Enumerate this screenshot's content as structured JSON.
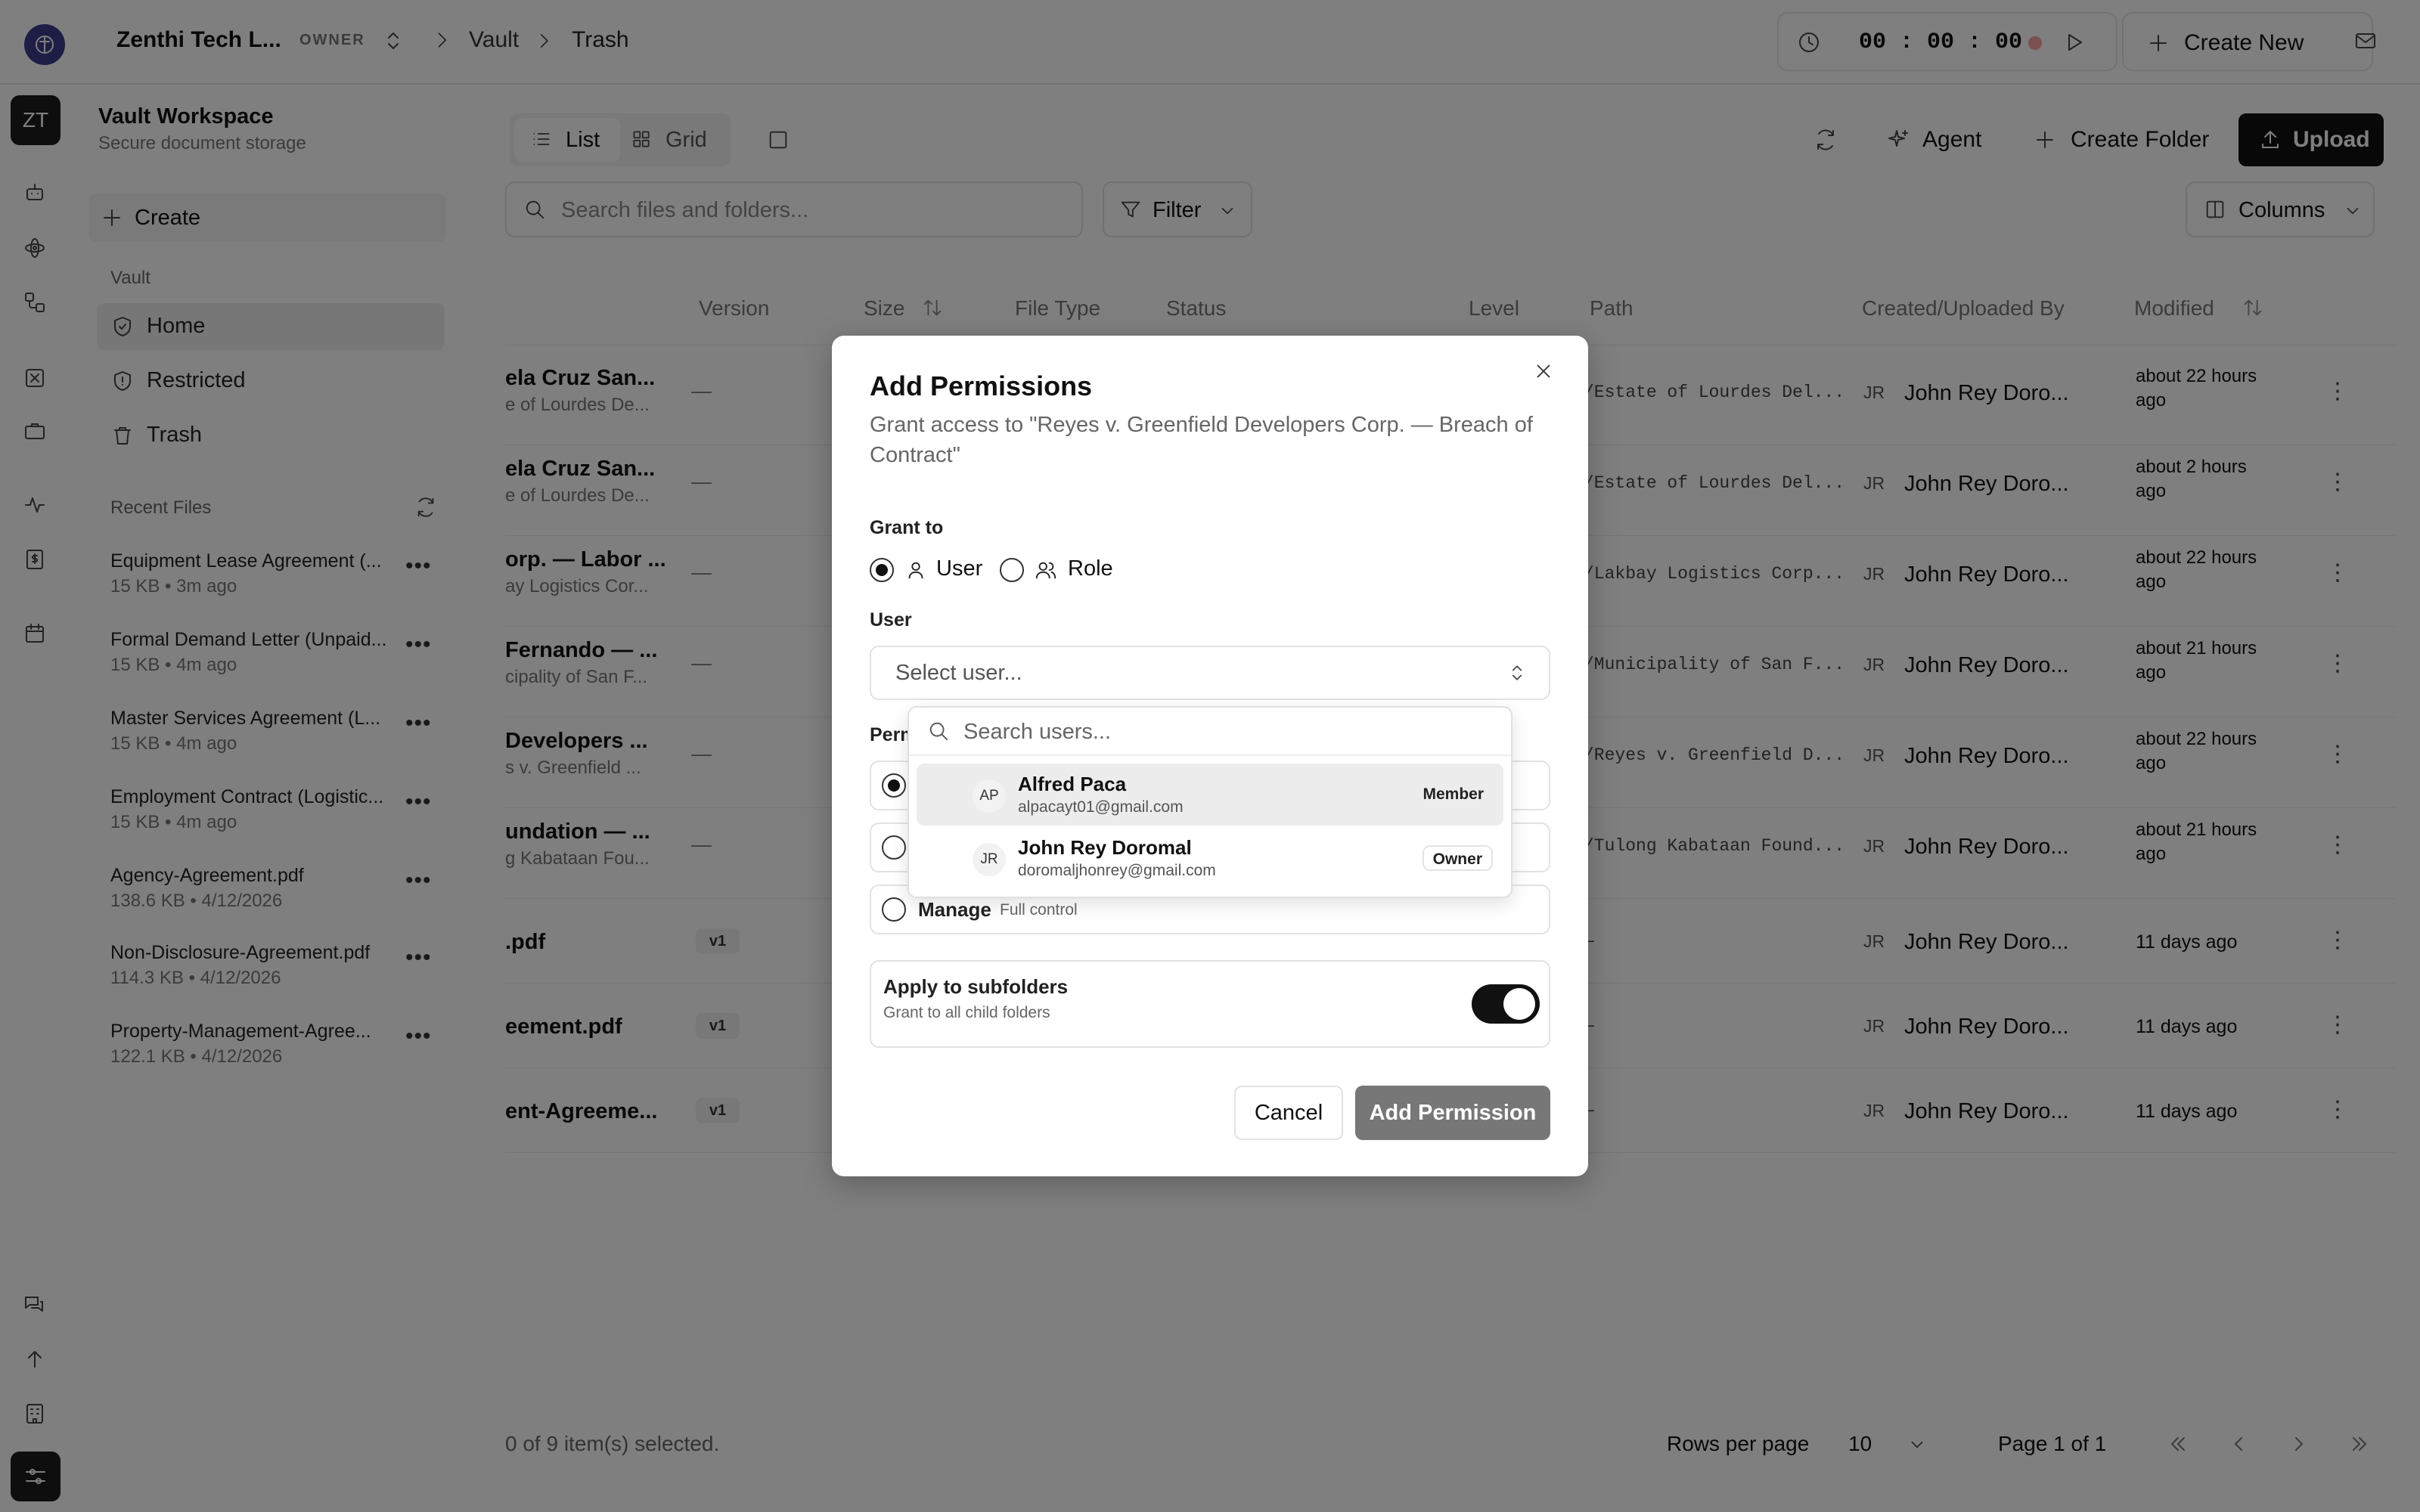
{
  "topbar": {
    "workspace_name": "Zenthi Tech L...",
    "role_badge": "OWNER",
    "breadcrumb": [
      "Vault",
      "Trash"
    ],
    "timer": "00 : 00 : 00",
    "create_new_label": "Create New"
  },
  "rail": {
    "avatar_initials": "ZT",
    "icons": [
      "bot-icon",
      "atom-icon",
      "workflow-icon",
      "square-x-icon",
      "briefcase-icon",
      "activity-icon",
      "dollar-file-icon",
      "calendar-icon"
    ],
    "bottom_icons": [
      "messages-icon",
      "arrow-up-icon",
      "building-icon",
      "settings-sliders-icon"
    ]
  },
  "sidebar": {
    "title": "Vault Workspace",
    "subtitle": "Secure document storage",
    "create_label": "Create",
    "section_label": "Vault",
    "items": [
      {
        "label": "Home",
        "icon": "shield-check-icon",
        "active": true
      },
      {
        "label": "Restricted",
        "icon": "shield-alert-icon",
        "active": false
      },
      {
        "label": "Trash",
        "icon": "trash-icon",
        "active": false
      }
    ],
    "recent_label": "Recent Files",
    "recent_files": [
      {
        "name": "Equipment Lease Agreement (...",
        "meta": "15 KB • 3m ago"
      },
      {
        "name": "Formal Demand Letter (Unpaid...",
        "meta": "15 KB • 4m ago"
      },
      {
        "name": "Master Services Agreement (L...",
        "meta": "15 KB • 4m ago"
      },
      {
        "name": "Employment Contract (Logistic...",
        "meta": "15 KB • 4m ago"
      },
      {
        "name": "Agency-Agreement.pdf",
        "meta": "138.6 KB • 4/12/2026"
      },
      {
        "name": "Non-Disclosure-Agreement.pdf",
        "meta": "114.3 KB • 4/12/2026"
      },
      {
        "name": "Property-Management-Agree...",
        "meta": "122.1 KB • 4/12/2026"
      }
    ]
  },
  "toolbar": {
    "list_label": "List",
    "grid_label": "Grid",
    "agent_label": "Agent",
    "create_folder_label": "Create Folder",
    "upload_label": "Upload",
    "search_placeholder": "Search files and folders...",
    "filter_label": "Filter",
    "columns_label": "Columns"
  },
  "table": {
    "headers": [
      "Version",
      "Size",
      "File Type",
      "Status",
      "Level",
      "Path",
      "Created/Uploaded By",
      "Modified"
    ],
    "rows": [
      {
        "name": "ela Cruz San...",
        "sub": "e of Lourdes De...",
        "version": "—",
        "path": "/Estate of Lourdes Del...",
        "by_initials": "JR",
        "by": "John Rey Doro...",
        "modified": [
          "about 22 hours",
          "ago"
        ]
      },
      {
        "name": "ela Cruz San...",
        "sub": "e of Lourdes De...",
        "version": "—",
        "path": "/Estate of Lourdes Del...",
        "by_initials": "JR",
        "by": "John Rey Doro...",
        "modified": [
          "about 2 hours",
          "ago"
        ]
      },
      {
        "name": "orp. — Labor ...",
        "sub": "ay Logistics Cor...",
        "version": "—",
        "path": "/Lakbay Logistics Corp...",
        "by_initials": "JR",
        "by": "John Rey Doro...",
        "modified": [
          "about 22 hours",
          "ago"
        ]
      },
      {
        "name": "Fernando — ...",
        "sub": "cipality of San F...",
        "version": "—",
        "path": "/Municipality of San F...",
        "by_initials": "JR",
        "by": "John Rey Doro...",
        "modified": [
          "about 21 hours",
          "ago"
        ]
      },
      {
        "name": "Developers ...",
        "sub": "s v. Greenfield ...",
        "version": "—",
        "path": "/Reyes v. Greenfield D...",
        "by_initials": "JR",
        "by": "John Rey Doro...",
        "modified": [
          "about 22 hours",
          "ago"
        ]
      },
      {
        "name": "undation — ...",
        "sub": "g Kabataan Fou...",
        "version": "—",
        "path": "/Tulong Kabataan Found...",
        "by_initials": "JR",
        "by": "John Rey Doro...",
        "modified": [
          "about 21 hours",
          "ago"
        ]
      },
      {
        "name": ".pdf",
        "sub": "",
        "version": "v1",
        "path": "—",
        "by_initials": "JR",
        "by": "John Rey Doro...",
        "modified": [
          "11 days ago",
          ""
        ]
      },
      {
        "name": "eement.pdf",
        "sub": "",
        "version": "v1",
        "path": "—",
        "by_initials": "JR",
        "by": "John Rey Doro...",
        "modified": [
          "11 days ago",
          ""
        ]
      },
      {
        "name": "ent-Agreeme...",
        "sub": "",
        "version": "v1",
        "path": "—",
        "by_initials": "JR",
        "by": "John Rey Doro...",
        "modified": [
          "11 days ago",
          ""
        ]
      }
    ]
  },
  "footer": {
    "selection": "0 of 9 item(s) selected.",
    "rows_per_page_label": "Rows per page",
    "rows_per_page_value": "10",
    "page_label": "Page 1 of 1"
  },
  "modal": {
    "title": "Add Permissions",
    "description": "Grant access to \"Reyes v. Greenfield Developers Corp. — Breach of Contract\"",
    "grant_to_label": "Grant to",
    "grant_options": [
      "User",
      "Role"
    ],
    "grant_selected": "User",
    "user_label": "User",
    "user_placeholder": "Select user...",
    "permission_label_partial": "Perm",
    "manage_label": "Manage",
    "manage_desc": "Full control",
    "subfolders_title": "Apply to subfolders",
    "subfolders_desc": "Grant to all child folders",
    "subfolders_on": true,
    "cancel_label": "Cancel",
    "submit_label": "Add Permission"
  },
  "user_dropdown": {
    "search_placeholder": "Search users...",
    "options": [
      {
        "initials": "AP",
        "name": "Alfred Paca",
        "email": "alpacayt01@gmail.com",
        "role": "Member"
      },
      {
        "initials": "JR",
        "name": "John Rey Doromal",
        "email": "doromaljhonrey@gmail.com",
        "role": "Owner"
      }
    ]
  }
}
